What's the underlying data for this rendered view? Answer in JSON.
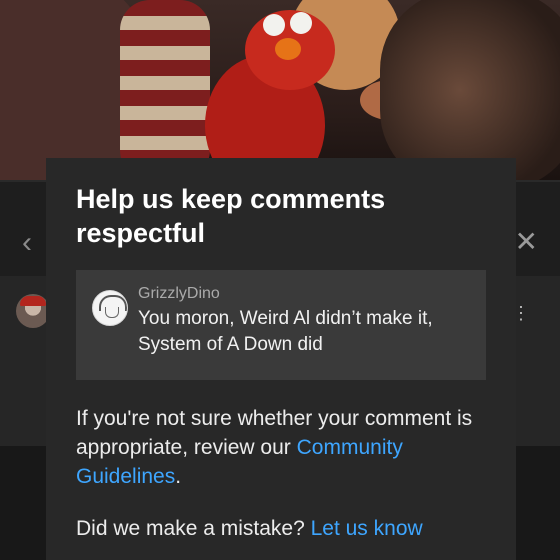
{
  "background": {
    "back_icon": "chevron-left-icon",
    "close_icon": "close-icon",
    "menu_icon": "more-vert-icon"
  },
  "dialog": {
    "title": "Help us keep comments respectful",
    "quoted_comment": {
      "username": "GrizzlyDino",
      "text": "You moron, Weird Al didn’t make it, System of A Down did"
    },
    "info_prefix": "If you're not sure whether your comment is appropriate, review our ",
    "info_link": "Community Guidelines",
    "info_suffix": ".",
    "mistake_prefix": "Did we make a mistake? ",
    "mistake_link": "Let us know"
  },
  "colors": {
    "sheet_bg": "#282828",
    "quote_bg": "#3a3a3a",
    "link": "#3ea6ff"
  }
}
